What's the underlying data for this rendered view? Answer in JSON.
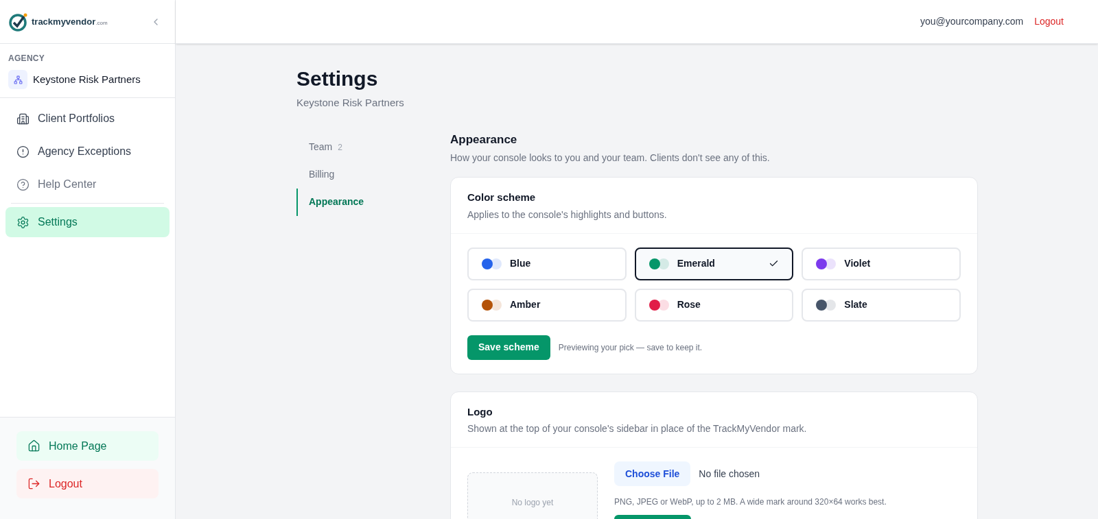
{
  "logo": {
    "name": "trackmyvendor",
    "suffix": ".com"
  },
  "agency": {
    "label": "AGENCY",
    "name": "Keystone Risk Partners"
  },
  "sidebar": {
    "items": [
      {
        "label": "Client Portfolios",
        "selected": false,
        "muted": false
      },
      {
        "label": "Agency Exceptions",
        "selected": false,
        "muted": false
      },
      {
        "label": "Help Center",
        "selected": false,
        "muted": true
      },
      {
        "label": "Settings",
        "selected": true,
        "muted": false
      }
    ],
    "home": "Home Page",
    "logout": "Logout"
  },
  "header": {
    "email": "you@yourcompany.com",
    "logout": "Logout"
  },
  "page": {
    "title": "Settings",
    "subtitle": "Keystone Risk Partners"
  },
  "tabs": [
    {
      "label": "Team",
      "count": "2",
      "selected": false
    },
    {
      "label": "Billing",
      "selected": false
    },
    {
      "label": "Appearance",
      "selected": true
    }
  ],
  "section": {
    "title": "Appearance",
    "description": "How your console looks to you and your team. Clients don't see any of this."
  },
  "color_scheme": {
    "title": "Color scheme",
    "description": "Applies to the console's highlights and buttons.",
    "options": [
      {
        "label": "Blue",
        "color": "#2563eb",
        "selected": false
      },
      {
        "label": "Emerald",
        "color": "#059669",
        "selected": true
      },
      {
        "label": "Violet",
        "color": "#7c3aed",
        "selected": false
      },
      {
        "label": "Amber",
        "color": "#b45309",
        "selected": false
      },
      {
        "label": "Rose",
        "color": "#e11d48",
        "selected": false
      },
      {
        "label": "Slate",
        "color": "#475569",
        "selected": false
      }
    ],
    "save": "Save scheme",
    "hint": "Previewing your pick — save to keep it."
  },
  "logo_section": {
    "title": "Logo",
    "description": "Shown at the top of your console's sidebar in place of the TrackMyVendor mark.",
    "empty": "No logo yet",
    "choose": "Choose File",
    "file_status": "No file chosen",
    "hint": "PNG, JPEG or WebP, up to 2 MB. A wide mark around 320×64 works best."
  }
}
